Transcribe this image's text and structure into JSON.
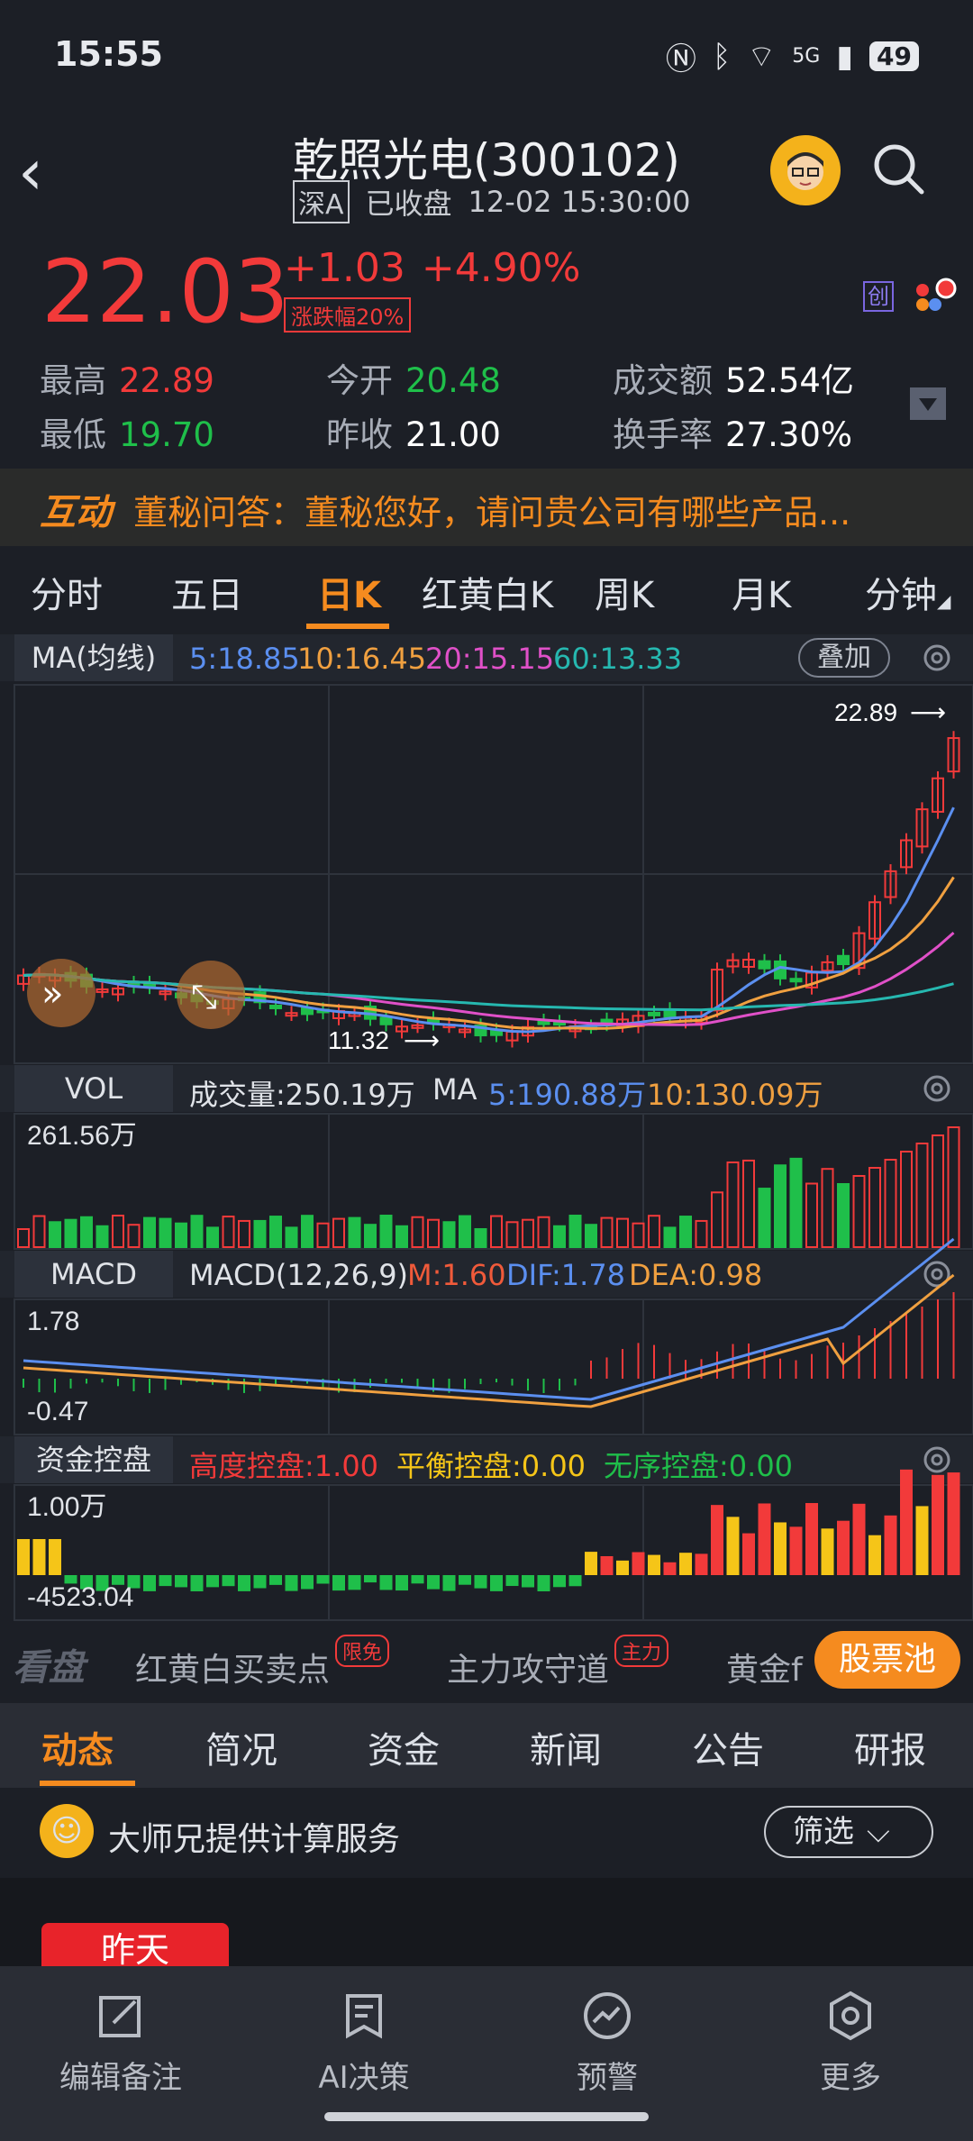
{
  "status_bar": {
    "time": "15:55",
    "signal": "5G",
    "battery": "49"
  },
  "header": {
    "title": "乾照光电(300102)",
    "market": "深A",
    "status": "已收盘",
    "datetime": "12-02 15:30:00"
  },
  "quote": {
    "price": "22.03",
    "change": "+1.03",
    "change_pct": "+4.90%",
    "limit_tag": "涨跌幅20%",
    "board_tag": "创",
    "stats": {
      "high_label": "最高",
      "high": "22.89",
      "low_label": "最低",
      "low": "19.70",
      "open_label": "今开",
      "open": "20.48",
      "prev_close_label": "昨收",
      "prev_close": "21.00",
      "amount_label": "成交额",
      "amount": "52.54亿",
      "turnover_label": "换手率",
      "turnover": "27.30%"
    }
  },
  "banner": {
    "tag": "互动",
    "text": "董秘问答：董秘您好，请问贵公司有哪些产品..."
  },
  "tabs": [
    "分时",
    "五日",
    "日K",
    "红黄白K",
    "周K",
    "月K",
    "分钟"
  ],
  "active_tab": "日K",
  "ma_row": {
    "label": "MA(均线)",
    "ma5": "5:18.85",
    "ma10": "10:16.45",
    "ma20": "20:15.15",
    "ma60": "60:13.33",
    "stack_button": "叠加",
    "max_marker": "22.89",
    "min_marker": "11.32"
  },
  "vol_row": {
    "label": "VOL",
    "text": "成交量:250.19万",
    "ma_label": "MA",
    "ma5": "5:190.88万",
    "ma10": "10:130.09万",
    "axis_max": "261.56万"
  },
  "macd_row": {
    "label": "MACD",
    "params": "MACD(12,26,9)",
    "m": "M:1.60",
    "dif": "DIF:1.78",
    "dea": "DEA:0.98",
    "axis_max": "1.78",
    "axis_min": "-0.47"
  },
  "fund_row": {
    "label": "资金控盘",
    "high": "高度控盘:1.00",
    "balance": "平衡控盘:0.00",
    "disorder": "无序控盘:0.00",
    "axis_max": "1.00万",
    "axis_min": "-4523.04"
  },
  "kanpan": {
    "label": "看盘",
    "item1": "红黄白买卖点",
    "badge1": "限免",
    "item2": "主力攻守道",
    "badge2": "主力",
    "item3": "黄金f",
    "pool": "股票池"
  },
  "news_tabs": [
    "动态",
    "简况",
    "资金",
    "新闻",
    "公告",
    "研报"
  ],
  "master": {
    "text": "大师兄提供计算服务",
    "filter": "筛选"
  },
  "feed": {
    "day": "昨天"
  },
  "bottom_nav": [
    "编辑备注",
    "AI决策",
    "预警",
    "更多"
  ],
  "colors": {
    "up": "#f23a3a",
    "down": "#1fbf4a",
    "accent": "#f58b1f",
    "ma5": "#5b8ff0",
    "ma10": "#f0a040",
    "ma20": "#e050c8",
    "ma60": "#26b8b0"
  }
}
